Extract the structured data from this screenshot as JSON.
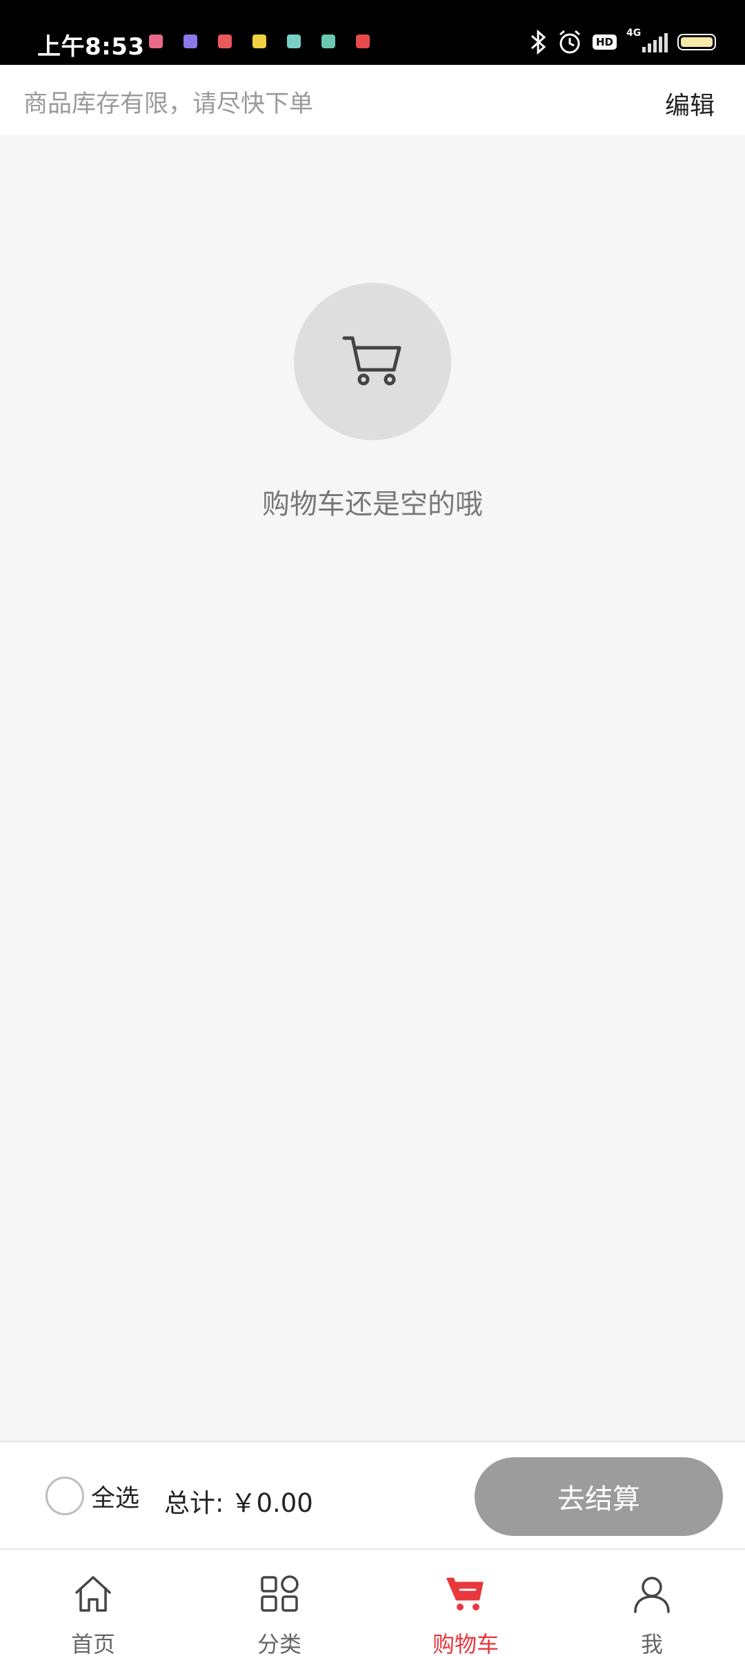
{
  "status_bar": {
    "time": "上午8:53",
    "hd": "HD",
    "network": "4G",
    "notification_icons": [
      "app-notification-icon",
      "app-notification-icon",
      "app-notification-icon",
      "app-notification-icon",
      "app-notification-icon",
      "app-notification-icon",
      "app-notification-icon"
    ],
    "system_icons": [
      "bluetooth-icon",
      "alarm-icon",
      "hd-icon",
      "signal-icon",
      "battery-icon"
    ]
  },
  "header": {
    "notice": "商品库存有限，请尽快下单",
    "edit_label": "编辑"
  },
  "empty_state": {
    "icon": "shopping-cart-icon",
    "message": "购物车还是空的哦"
  },
  "checkout": {
    "select_all_label": "全选",
    "total_label": "总计:",
    "total_amount": "￥0.00",
    "checkout_label": "去结算"
  },
  "tab_bar": {
    "active": "cart",
    "tabs": [
      {
        "id": "home",
        "label": "首页",
        "icon": "home-icon"
      },
      {
        "id": "category",
        "label": "分类",
        "icon": "category-icon"
      },
      {
        "id": "cart",
        "label": "购物车",
        "icon": "shopping-cart-icon"
      },
      {
        "id": "me",
        "label": "我",
        "icon": "user-icon"
      }
    ]
  },
  "colors": {
    "accent": "#e9373e",
    "checkout_button": "#9c9c9c",
    "background": "#f6f6f6"
  }
}
